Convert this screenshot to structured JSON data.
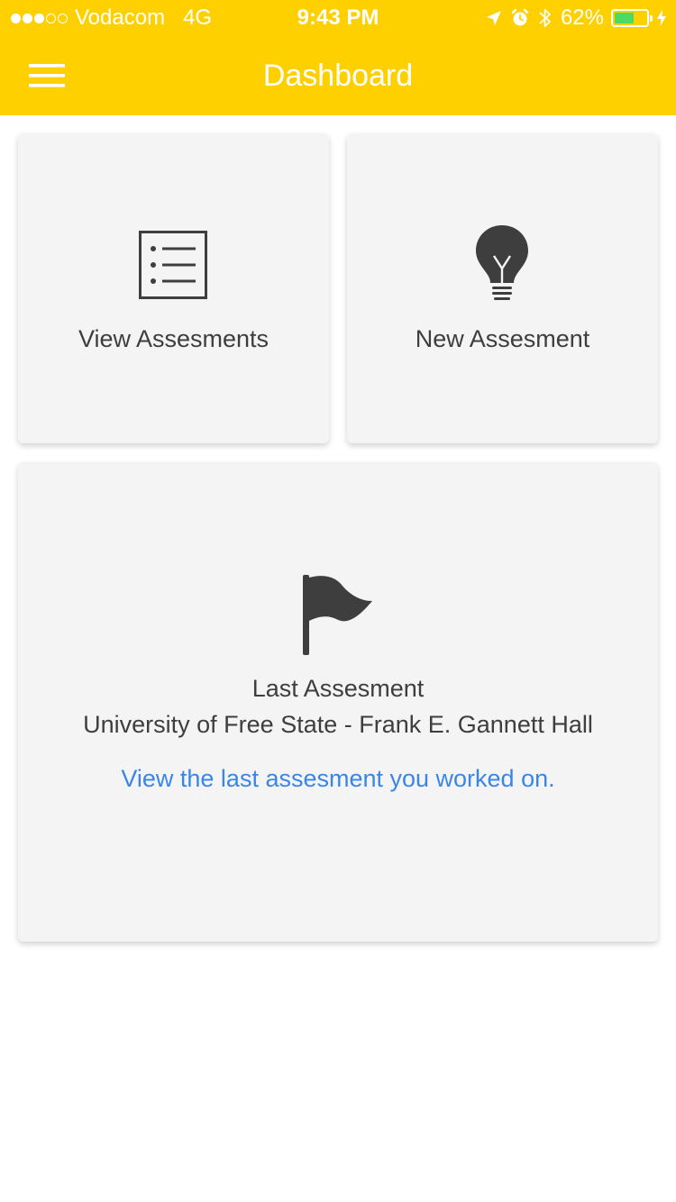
{
  "status_bar": {
    "carrier": "Vodacom",
    "network": "4G",
    "time": "9:43 PM",
    "battery_percent_label": "62%",
    "battery_level": 0.62,
    "signal_bars_filled": 3,
    "signal_bars_total": 5,
    "icons": [
      "location-arrow-icon",
      "alarm-icon",
      "bluetooth-icon",
      "battery-icon",
      "charging-bolt-icon"
    ]
  },
  "header": {
    "title": "Dashboard",
    "menu_icon": "hamburger-menu-icon"
  },
  "cards": {
    "view_assessments": {
      "label": "View Assesments",
      "icon": "list-icon"
    },
    "new_assessment": {
      "label": "New Assesment",
      "icon": "lightbulb-icon"
    },
    "last_assessment": {
      "title": "Last Assesment",
      "subtitle": "University of Free State - Frank E. Gannett Hall",
      "link": "View the last assesment you worked on.",
      "icon": "flag-icon"
    }
  },
  "colors": {
    "brand_yellow": "#FFD000",
    "card_background": "#F4F4F4",
    "text_dark": "#3E3E3E",
    "icon_dark": "#3E3E3E",
    "link_blue": "#3A86E8",
    "battery_green": "#4CD964"
  }
}
